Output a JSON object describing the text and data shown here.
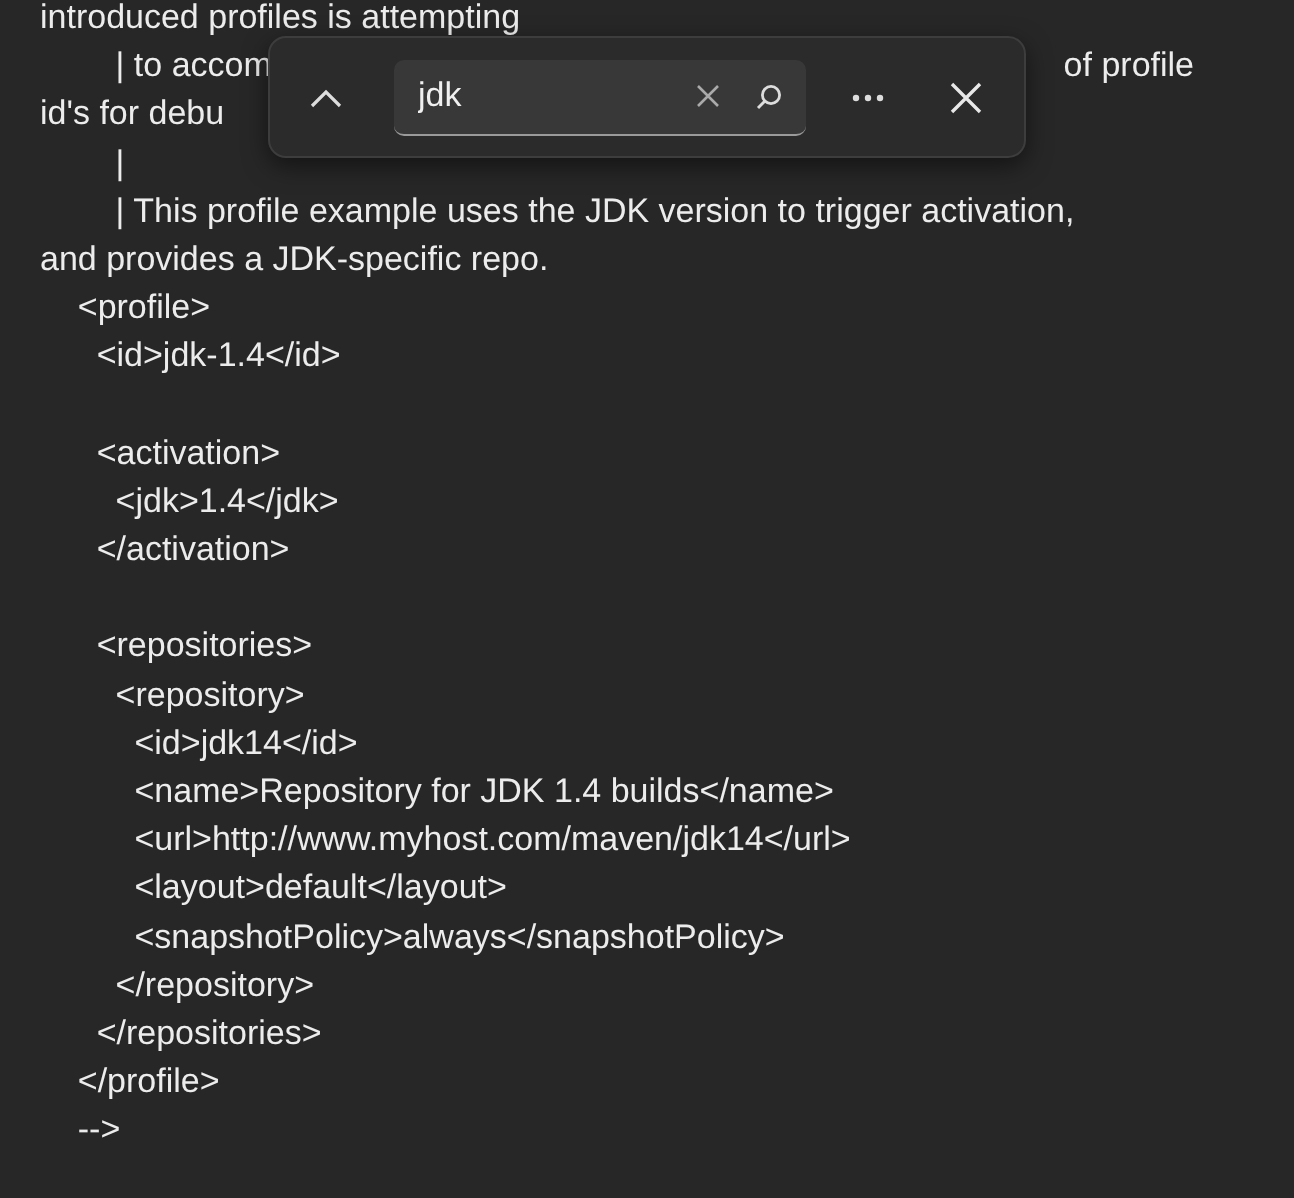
{
  "editor": {
    "lines": [
      {
        "text": "introduced profiles is attempting"
      },
      {
        "text": "        | to accom",
        "text_after_bar": "of profile"
      },
      {
        "text": "id's for debu"
      },
      {
        "text": "        |"
      },
      {
        "text": "        | This profile example uses the JDK version to trigger activation,"
      },
      {
        "text": "and provides a JDK-specific repo."
      },
      {
        "text": "    <profile>"
      },
      {
        "text": "      <id>jdk-1.4</id>"
      },
      {
        "text": "      <activation>",
        "blank_line_before": true
      },
      {
        "text": "        <jdk>1.4</jdk>"
      },
      {
        "text": "      </activation>"
      },
      {
        "text": "      <repositories>",
        "blank_line_before": true
      },
      {
        "text": "        <repository>"
      },
      {
        "text": "          <id>jdk14</id>"
      },
      {
        "text": "          <name>Repository for JDK 1.4 builds</name>"
      },
      {
        "text": "          <url>http://www.myhost.com/maven/jdk14</url>"
      },
      {
        "text": "          <layout>default</layout>"
      },
      {
        "text": "          <snapshotPolicy>always</snapshotPolicy>"
      },
      {
        "text": "        </repository>"
      },
      {
        "text": "      </repositories>"
      },
      {
        "text": "    </profile>"
      },
      {
        "text": "    -->"
      }
    ]
  },
  "find_bar": {
    "value": "jdk"
  }
}
